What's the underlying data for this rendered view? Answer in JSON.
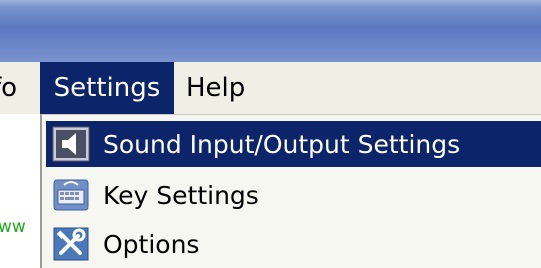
{
  "menubar": {
    "items": [
      {
        "label": "fo"
      },
      {
        "label": "Settings"
      },
      {
        "label": "Help"
      }
    ],
    "active_index": 1
  },
  "left_content": {
    "text": "ww"
  },
  "dropdown": {
    "items": [
      {
        "label": "Sound Input/Output Settings",
        "icon": "speaker-icon",
        "highlighted": true
      },
      {
        "label": "Key Settings",
        "icon": "keyboard-icon",
        "highlighted": false
      },
      {
        "label": "Options",
        "icon": "tools-icon",
        "highlighted": false
      }
    ]
  },
  "colors": {
    "selection": "#0b246a",
    "menubar_bg": "#f0efe6",
    "titlebar_blue": "#5b78c0"
  }
}
